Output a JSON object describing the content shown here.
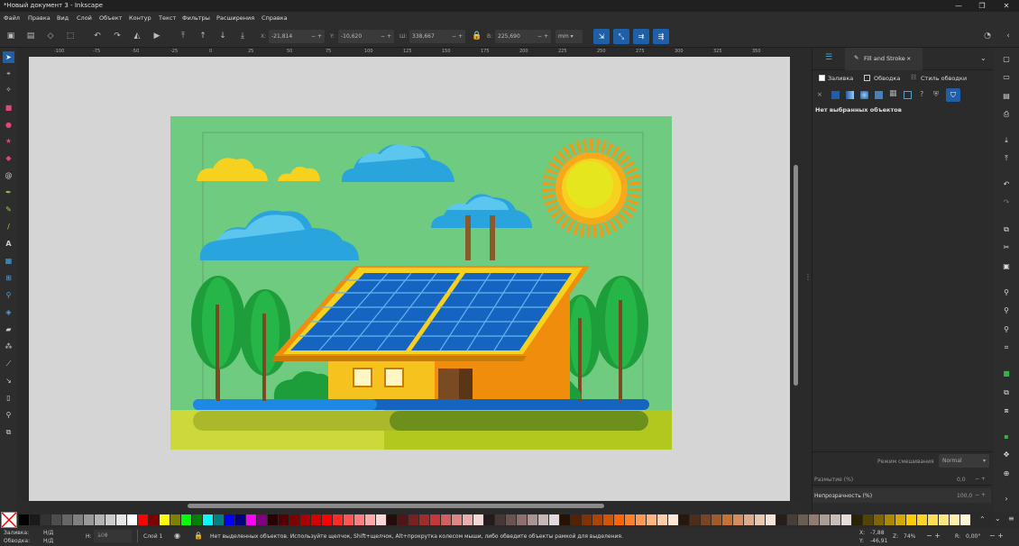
{
  "window": {
    "title": "*Новый документ 3 - Inkscape",
    "minimize": "—",
    "maximize": "❐",
    "close": "✕"
  },
  "menu": [
    "Файл",
    "Правка",
    "Вид",
    "Слой",
    "Объект",
    "Контур",
    "Текст",
    "Фильтры",
    "Расширения",
    "Справка"
  ],
  "coords": {
    "x_label": "X:",
    "x_value": "-21,814",
    "y_label": "Y:",
    "y_value": "-10,620",
    "w_label": "Ш:",
    "w_value": "338,667",
    "h_label": "В:",
    "h_value": "225,690",
    "unit": "mm"
  },
  "ruler_labels": [
    "-100",
    "-75",
    "-50",
    "-25",
    "0",
    "25",
    "50",
    "75",
    "100",
    "125",
    "150",
    "175",
    "200",
    "225",
    "250",
    "275",
    "300",
    "325",
    "350"
  ],
  "panel": {
    "tab_title": "Fill and Stroke",
    "subtabs": [
      "Заливка",
      "Обводка",
      "Стиль обводки"
    ],
    "no_selection": "Нет выбранных объектов",
    "blend_label": "Режим смешивания",
    "blend_value": "Normal",
    "blur_label": "Размытие (%)",
    "blur_value": "0,0",
    "opacity_label": "Непрозрачность (%)",
    "opacity_value": "100,0"
  },
  "status": {
    "fill_label": "Заливка:",
    "fill_value": "Н/Д",
    "stroke_label": "Обводка:",
    "stroke_value": "Н/Д",
    "h_label": "Н:",
    "h_value": "100",
    "layer": "Слой 1",
    "message": "Нет выделенных объектов. Используйте щелчок, Shift+щелчок, Alt+прокрутка колесом мыши, либо обведите объекты рамкой для выделения.",
    "x_label": "X:",
    "x_value": "-7,88",
    "y_label": "Y:",
    "y_value": "-46,91",
    "zoom_label": "Z:",
    "zoom_value": "74%",
    "rot_label": "R:",
    "rot_value": "0,00°"
  },
  "palette_colors": [
    "#000000",
    "#1a1a1a",
    "#333333",
    "#4d4d4d",
    "#666666",
    "#808080",
    "#999999",
    "#b3b3b3",
    "#cccccc",
    "#e6e6e6",
    "#ffffff",
    "#ff0000",
    "#800000",
    "#ffff00",
    "#808000",
    "#00ff00",
    "#008000",
    "#00ffff",
    "#008080",
    "#0000ff",
    "#000080",
    "#ff00ff",
    "#800080",
    "#2b0000",
    "#550000",
    "#800000",
    "#aa0000",
    "#d40000",
    "#ff0000",
    "#ff2a2a",
    "#ff5555",
    "#ff8080",
    "#ffaaaa",
    "#ffd5d5",
    "#280b0b",
    "#501616",
    "#782121",
    "#a02c2c",
    "#c83737",
    "#d35f5f",
    "#de8787",
    "#e9afaf",
    "#f4d7d7",
    "#241c1c",
    "#483737",
    "#6c5353",
    "#916f6f",
    "#ac9393",
    "#c8b7b7",
    "#e3dbdb",
    "#2b1100",
    "#552200",
    "#803300",
    "#aa4400",
    "#d45500",
    "#ff6600",
    "#ff7f2a",
    "#ff9955",
    "#ffb380",
    "#ffccaa",
    "#ffe6d5",
    "#28170b",
    "#502d16",
    "#784421",
    "#a05a2c",
    "#c87137",
    "#d38d5f",
    "#deaa87",
    "#e9c6af",
    "#f4e3d7",
    "#241f1c",
    "#483e37",
    "#6c5d53",
    "#917c6f",
    "#ac9d93",
    "#c8beb7",
    "#e3dedb",
    "#2b2200",
    "#554400",
    "#806600",
    "#aa8800",
    "#d4aa00",
    "#ffcc00",
    "#ffd42a",
    "#ffdd55",
    "#ffe680",
    "#ffeeaa",
    "#fff6d5"
  ],
  "icons": {
    "tools": [
      "selector-icon",
      "node-icon",
      "tweak-icon",
      "rect-icon",
      "ellipse-icon",
      "star-icon",
      "box3d-icon",
      "spiral-icon",
      "pen-icon",
      "pencil-icon",
      "calligraphy-icon",
      "text-icon",
      "gradient-icon",
      "mesh-icon",
      "dropper-icon",
      "paint-bucket-icon",
      "eraser-icon",
      "spray-icon",
      "measure-icon",
      "connector-icon",
      "page-icon",
      "zoom-icon",
      "pages-icon"
    ],
    "right": [
      "new-doc-icon",
      "open-icon",
      "save-icon",
      "print-icon",
      "import-icon",
      "export-icon",
      "undo-icon",
      "redo-icon",
      "copy-icon",
      "cut-icon",
      "paste-icon",
      "zoom-selection-icon",
      "zoom-drawing-icon",
      "zoom-page-icon",
      "zoom-fit-icon",
      "duplicate-icon",
      "clone-icon",
      "unlink-clone-icon",
      "group-icon",
      "ungroup-icon",
      "xml-editor-icon",
      "align-icon",
      "more-icon"
    ]
  }
}
